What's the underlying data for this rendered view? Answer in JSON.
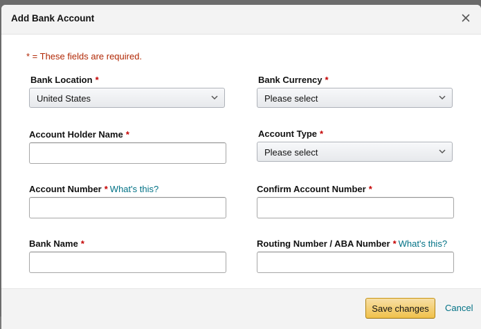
{
  "dialog": {
    "title": "Add Bank Account",
    "close_icon": "close-icon",
    "required_note": "* = These fields are required."
  },
  "fields": {
    "bank_location": {
      "label": "Bank Location",
      "required_mark": "*",
      "value": "United States"
    },
    "bank_currency": {
      "label": "Bank Currency",
      "required_mark": "*",
      "value": "Please select"
    },
    "account_holder_name": {
      "label": "Account Holder Name",
      "required_mark": "*",
      "value": ""
    },
    "account_type": {
      "label": "Account Type",
      "required_mark": "*",
      "value": "Please select"
    },
    "account_number": {
      "label": "Account Number",
      "required_mark": "*",
      "help_link": "What's this?",
      "value": ""
    },
    "confirm_account_number": {
      "label": "Confirm Account Number",
      "required_mark": "*",
      "value": ""
    },
    "bank_name": {
      "label": "Bank Name",
      "required_mark": "*",
      "value": ""
    },
    "routing_number": {
      "label": "Routing Number / ABA Number",
      "required_mark": "*",
      "help_link": "What's this?",
      "value": ""
    }
  },
  "footer": {
    "save_label": "Save changes",
    "cancel_label": "Cancel"
  },
  "colors": {
    "required": "#c40000",
    "note": "#b12704",
    "link": "#007185",
    "primary_button": "#f0c14b"
  }
}
